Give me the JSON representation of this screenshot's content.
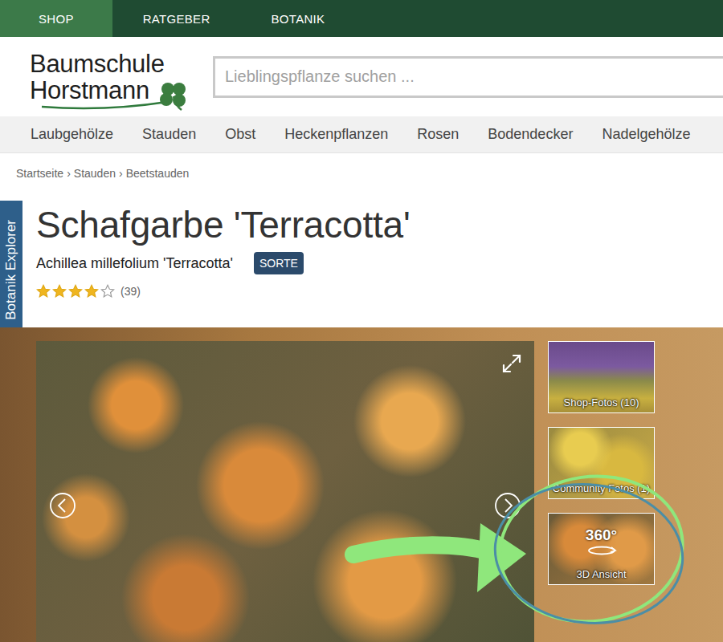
{
  "top_nav": [
    {
      "label": "SHOP",
      "selected": true
    },
    {
      "label": "RATGEBER",
      "selected": false
    },
    {
      "label": "BOTANIK",
      "selected": false
    }
  ],
  "logo": {
    "line1": "Baumschule",
    "line2": "Horstmann"
  },
  "search": {
    "placeholder": "Lieblingspflanze suchen ..."
  },
  "categories": [
    "Laubgehölze",
    "Stauden",
    "Obst",
    "Heckenpflanzen",
    "Rosen",
    "Bodendecker",
    "Nadelgehölze"
  ],
  "breadcrumb": {
    "items": [
      "Startseite",
      "Stauden",
      "Beetstauden"
    ],
    "separator": "›"
  },
  "side_tab": {
    "label": "Botanik Explorer"
  },
  "product": {
    "title": "Schafgarbe 'Terracotta'",
    "botanical_name": "Achillea millefolium 'Terracotta'",
    "badge": "SORTE",
    "rating": {
      "stars": 4,
      "count": "(39)"
    }
  },
  "gallery": {
    "thumbnails": [
      {
        "kind": "photo",
        "label": "Shop-Fotos (10)"
      },
      {
        "kind": "photo",
        "label": "Community Fotos (1)"
      },
      {
        "kind": "view360",
        "badge": "360°",
        "label": "3D Ansicht"
      }
    ]
  }
}
